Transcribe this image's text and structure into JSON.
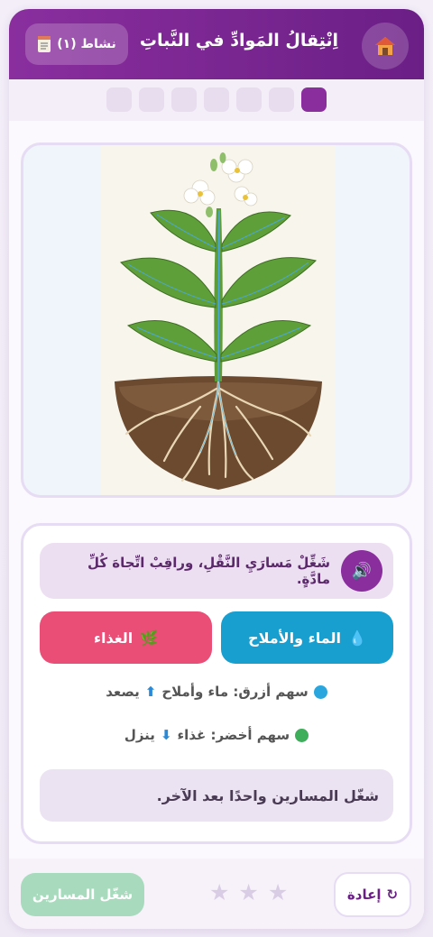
{
  "header": {
    "title": "اِنْتِقالُ المَوادِّ في النَّباتِ",
    "activity_label": "نشاط (١)",
    "home_icon": "house-icon",
    "activity_icon": "memo-icon"
  },
  "progress": {
    "total_steps": 7,
    "current_step": 1
  },
  "illustration": {
    "subject": "plant-with-roots-and-flowers"
  },
  "instruction": {
    "text": "شَغِّلْ مَسارَيِ النَّقْلِ، وراقِبْ اتِّجاهَ كُلِّ مادَّةٍ.",
    "speaker_icon": "speaker-icon"
  },
  "flows": {
    "water_label": "الماء والأملاح",
    "water_icon": "droplet-icon",
    "food_label": "الغذاء",
    "food_icon": "leaf-icon"
  },
  "legend": {
    "blue_text": "سهم أزرق: ماء وأملاح",
    "blue_dir": "يصعد",
    "green_text": "سهم أخضر: غذاء",
    "green_dir": "ينزل",
    "blue_color": "#2aa6de",
    "green_color": "#3fae5a"
  },
  "hint": "شغّل المسارين واحدًا بعد الآخر.",
  "footer": {
    "reset_label": "إعادة",
    "run_label": "شغّل المسارين",
    "stars_earned": 0,
    "stars_total": 3
  },
  "colors": {
    "brand": "#8a2e9e",
    "water": "#199ed0",
    "food": "#ea4d76"
  }
}
